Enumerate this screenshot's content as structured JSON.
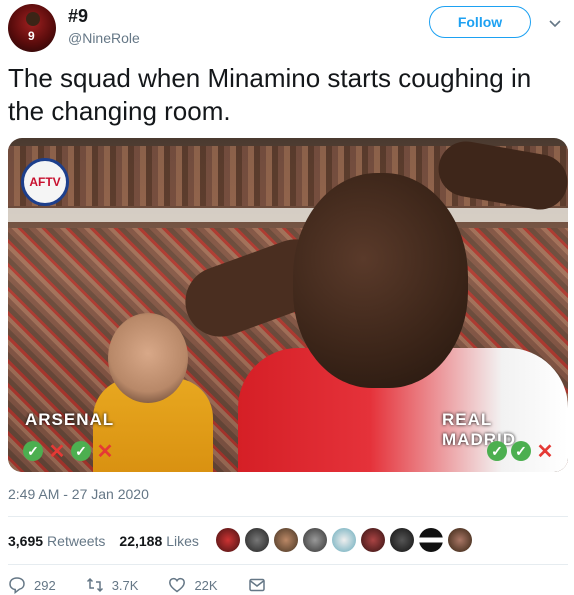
{
  "tweet": {
    "display_name": "#9",
    "handle": "@NineRole",
    "follow_label": "Follow",
    "text": "The squad when Minamino starts coughing in the changing room.",
    "date": "2:49 AM - 27 Jan 2020"
  },
  "media": {
    "badge_text": "AFTV",
    "left_team": "ARSENAL",
    "right_team": "REAL MADRID"
  },
  "stats": {
    "retweets_count": "3,695",
    "retweets_label": "Retweets",
    "likes_count": "22,188",
    "likes_label": "Likes"
  },
  "actions": {
    "replies": "292",
    "retweets": "3.7K",
    "likes": "22K"
  },
  "colors": {
    "accent": "#1da1f2",
    "muted": "#657786",
    "divider": "#e6ecf0"
  }
}
